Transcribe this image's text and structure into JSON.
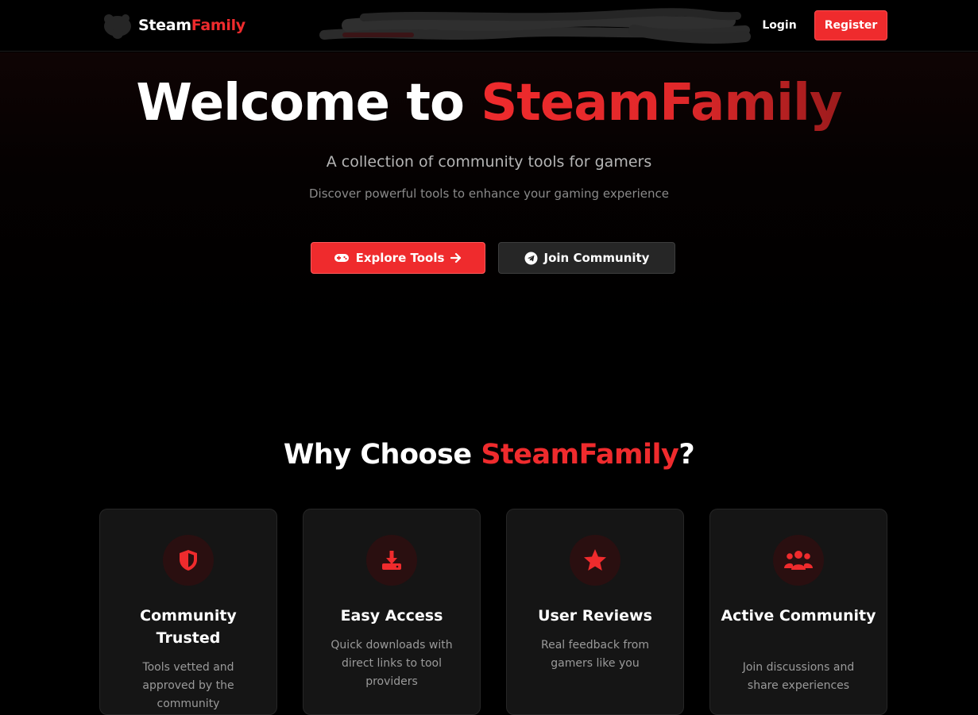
{
  "navbar": {
    "brand_part1": "Steam",
    "brand_part2": "Family",
    "login_label": "Login",
    "register_label": "Register"
  },
  "hero": {
    "title_part1": "Welcome to ",
    "title_part2": "SteamFamily",
    "subtitle": "A collection of community tools for gamers",
    "tagline": "Discover powerful tools to enhance your gaming experience",
    "explore_label": "Explore Tools",
    "join_label": "Join Community"
  },
  "why": {
    "title_part1": "Why Choose ",
    "title_part2": "SteamFamily",
    "title_part3": "?"
  },
  "features": [
    {
      "icon": "shield-icon",
      "title": "Community Trusted",
      "description": "Tools vetted and approved by the community"
    },
    {
      "icon": "download-icon",
      "title": "Easy Access",
      "description": "Quick downloads with direct links to tool providers"
    },
    {
      "icon": "star-icon",
      "title": "User Reviews",
      "description": "Real feedback from gamers like you"
    },
    {
      "icon": "users-icon",
      "title": "Active Community",
      "description": "Join discussions and share experiences"
    }
  ],
  "colors": {
    "accent": "#ef2b2d",
    "background": "#000000",
    "card": "#151515",
    "secondary_button": "#262626"
  }
}
